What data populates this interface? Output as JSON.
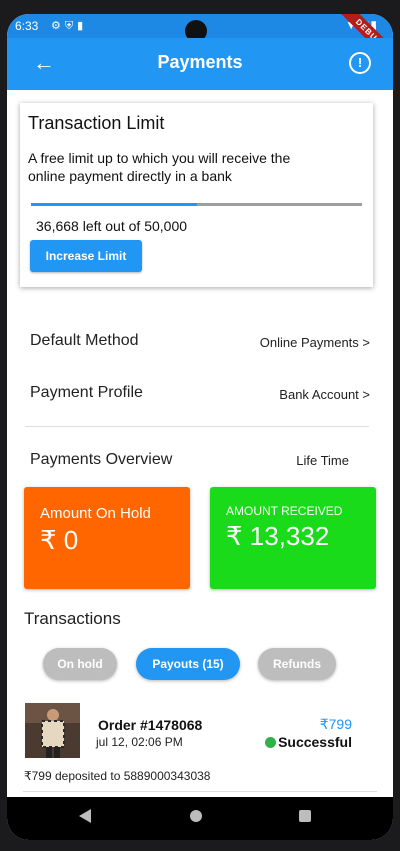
{
  "status_bar": {
    "time": "6:33",
    "left_icons": [
      "gear-icon",
      "shield-icon",
      "sd-card-icon"
    ],
    "right_icons": [
      "wifi-icon",
      "signal-icon",
      "battery-icon"
    ],
    "debug_banner": "DEBUG"
  },
  "appbar": {
    "title": "Payments",
    "back_icon": "arrow-left-icon",
    "info_icon": "info-icon"
  },
  "transaction_limit": {
    "title": "Transaction Limit",
    "description": "A free limit up to which you will receive the online payment directly in a bank",
    "used_fraction": 0.5,
    "left_text": "36,668 left  out of 50,000",
    "button_label": "Increase Limit"
  },
  "settings": {
    "default_method": {
      "label": "Default Method",
      "value": "Online Payments  >"
    },
    "payment_profile": {
      "label": "Payment Profile",
      "value": "Bank Account  >"
    }
  },
  "overview": {
    "title": "Payments Overview",
    "range": "Life Time",
    "on_hold": {
      "label": "Amount On Hold",
      "amount": "₹ 0",
      "color": "#ff6600"
    },
    "received": {
      "label": "AMOUNT RECEIVED",
      "amount": "₹ 13,332",
      "color": "#1adb1a"
    }
  },
  "transactions": {
    "title": "Transactions",
    "tabs": [
      {
        "label": "On hold",
        "selected": false
      },
      {
        "label": "Payouts (15)",
        "selected": true
      },
      {
        "label": "Refunds",
        "selected": false
      }
    ],
    "items": [
      {
        "order": "Order #1478068",
        "date": "jul  12, 02:06 PM",
        "amount": "₹799",
        "status": "Successful",
        "note": "₹799 deposited to 5889000343038"
      }
    ]
  },
  "accent_color": "#2196f3"
}
